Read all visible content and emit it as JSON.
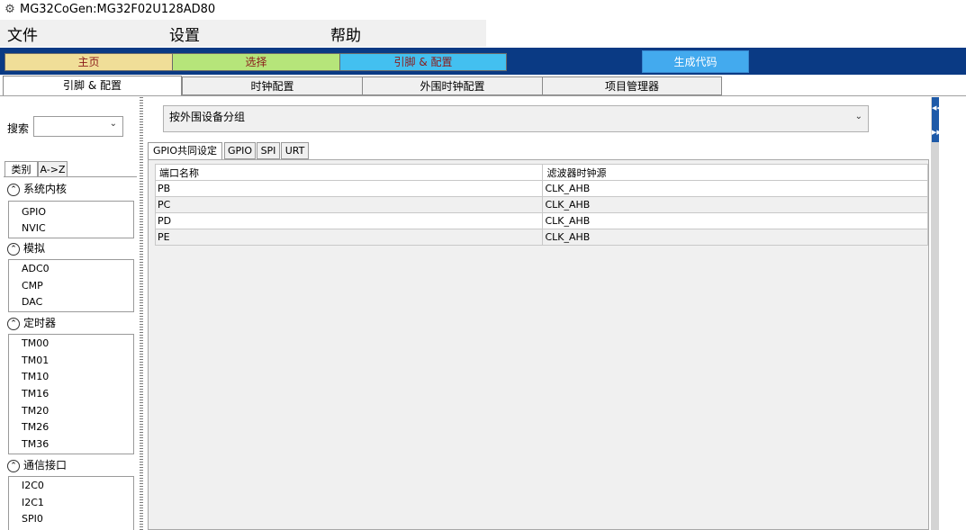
{
  "window": {
    "title": "MG32CoGen:MG32F02U128AD80",
    "icon": "gear-icon"
  },
  "menu": {
    "file": "文件",
    "settings": "设置",
    "help": "帮助"
  },
  "nav": {
    "home": "主页",
    "select": "选择",
    "pin_config": "引脚 & 配置",
    "generate": "生成代码",
    "colors": {
      "home": "#f0de98",
      "select": "#b6e57a",
      "pin_config": "#43c0f0",
      "generate": "#43aaee"
    }
  },
  "main_tabs": [
    "引脚 & 配置",
    "时钟配置",
    "外围时钟配置",
    "项目管理器"
  ],
  "left": {
    "search_label": "搜索",
    "search_value": "",
    "tab_category": "类别",
    "tab_az": "A->Z",
    "categories": [
      {
        "name": "系统内核",
        "items": [
          "GPIO",
          "NVIC"
        ]
      },
      {
        "name": "模拟",
        "items": [
          "ADC0",
          "CMP",
          "DAC"
        ]
      },
      {
        "name": "定时器",
        "items": [
          "TM00",
          "TM01",
          "TM10",
          "TM16",
          "TM20",
          "TM26",
          "TM36"
        ]
      },
      {
        "name": "通信接口",
        "items": [
          "I2C0",
          "I2C1",
          "SPI0"
        ]
      }
    ]
  },
  "content": {
    "group_by": "按外围设备分组",
    "config_tabs": [
      "GPIO共同设定",
      "GPIO",
      "SPI",
      "URT"
    ],
    "table": {
      "headers": [
        "端口名称",
        "滤波器时钟源"
      ],
      "rows": [
        [
          "PB",
          "CLK_AHB"
        ],
        [
          "PC",
          "CLK_AHB"
        ],
        [
          "PD",
          "CLK_AHB"
        ],
        [
          "PE",
          "CLK_AHB"
        ]
      ]
    }
  }
}
